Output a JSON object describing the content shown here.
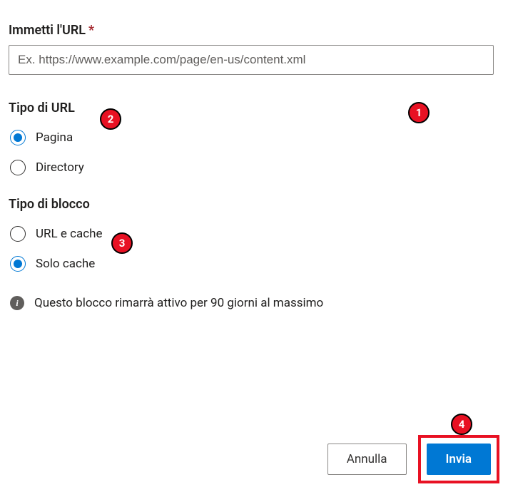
{
  "url_field": {
    "label": "Immetti l'URL",
    "required_mark": "*",
    "placeholder": "Ex. https://www.example.com/page/en-us/content.xml",
    "value": ""
  },
  "url_type": {
    "heading": "Tipo di URL",
    "options": {
      "page": {
        "label": "Pagina",
        "checked": true
      },
      "directory": {
        "label": "Directory",
        "checked": false
      }
    }
  },
  "block_type": {
    "heading": "Tipo di blocco",
    "options": {
      "url_and_cache": {
        "label": "URL e cache",
        "checked": false
      },
      "cache_only": {
        "label": "Solo cache",
        "checked": true
      }
    }
  },
  "info": {
    "text": "Questo blocco rimarrà attivo per 90 giorni al massimo"
  },
  "footer": {
    "cancel": "Annulla",
    "submit": "Invia"
  },
  "callouts": {
    "c1": "1",
    "c2": "2",
    "c3": "3",
    "c4": "4"
  }
}
